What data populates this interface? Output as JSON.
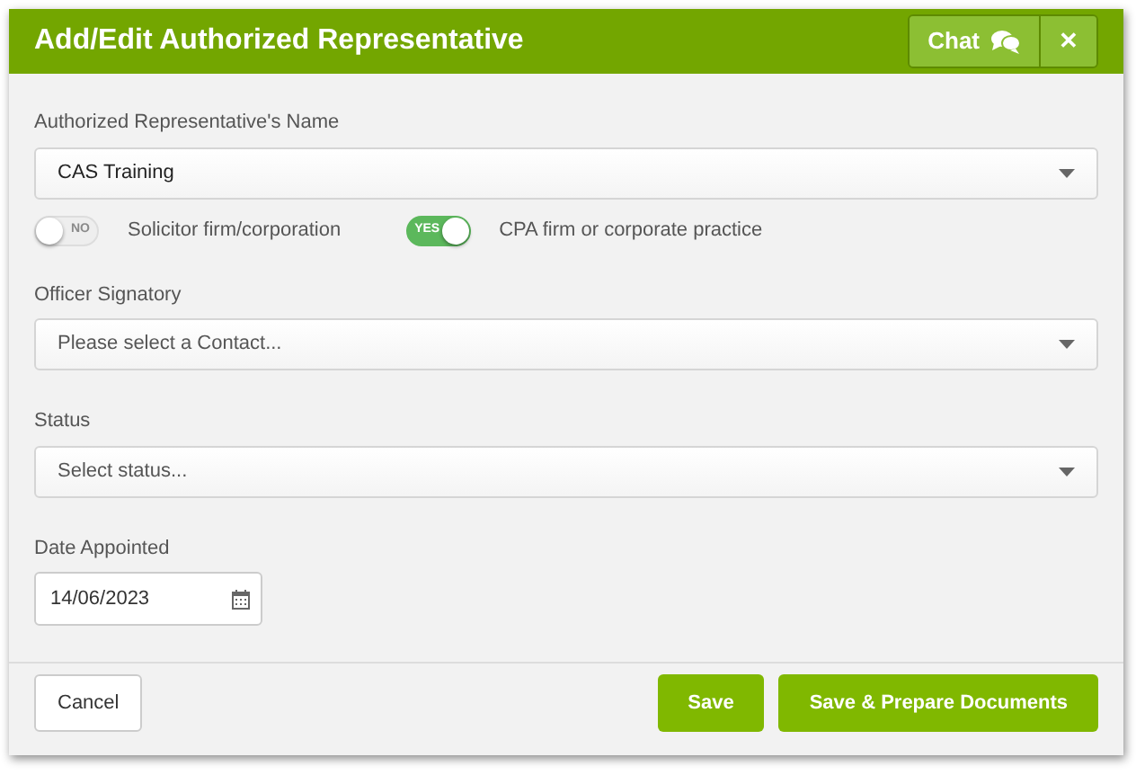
{
  "window": {
    "title": "Add/Edit Authorized Representative"
  },
  "header_buttons": {
    "chat": "Chat",
    "close": "✕"
  },
  "representative_name": {
    "label": "Authorized Representative's Name",
    "value": "CAS Training"
  },
  "toggles": [
    {
      "text": "NO",
      "label": "Solicitor firm/corporation",
      "on": false
    },
    {
      "text": "YES",
      "label": "CPA firm or corporate practice",
      "on": true
    }
  ],
  "officer_signatory": {
    "label": "Officer Signatory",
    "placeholder": "Please select a Contact..."
  },
  "status": {
    "label": "Status",
    "placeholder": "Select status..."
  },
  "date_appointed": {
    "label": "Date Appointed",
    "value": "14/06/2023"
  },
  "footer_buttons": [
    {
      "label": "Cancel",
      "kind": "secondary"
    },
    {
      "label": "Save",
      "kind": "primary"
    },
    {
      "label": "Save & Prepare Documents",
      "kind": "primary"
    }
  ]
}
